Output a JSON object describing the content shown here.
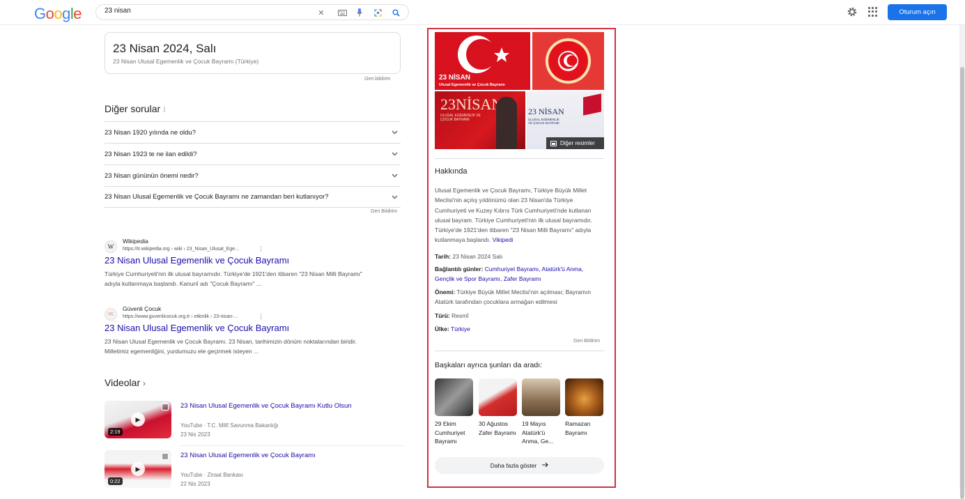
{
  "header": {
    "logo_letters": [
      "G",
      "o",
      "o",
      "g",
      "l",
      "e"
    ],
    "search_query": "23 nisan",
    "signin_label": "Oturum açın"
  },
  "date_card": {
    "title": "23 Nisan 2024, Salı",
    "subtitle": "23 Nisan Ulusal Egemenlik ve Çocuk Bayramı (Türkiye)",
    "feedback": "Geri bildirim"
  },
  "paa": {
    "title": "Diğer sorular",
    "items": [
      "23 Nisan 1920 yılında ne oldu?",
      "23 Nisan 1923 te ne ilan edildi?",
      "23 Nisan gününün önemi nedir?",
      "23 Nisan Ulusal Egemenlik ve Çocuk Bayramı ne zamandan beri kutlanıyor?"
    ],
    "feedback": "Geri Bildirim"
  },
  "results": [
    {
      "favicon": "W",
      "site": "Wikipedia",
      "url": "https://tr.wikipedia.org › wiki › 23_Nisan_Ulusal_Ege...",
      "title": "23 Nisan Ulusal Egemenlik ve Çocuk Bayramı",
      "snippet": "Türkiye Cumhuriyeti'nin ilk ulusal bayramıdır. Türkiye'de 1921'den itibaren \"23 Nisan Milli Bayramı\" adıyla kutlanmaya başlandı. Kanunî adı \"Çocuk Bayramı\" ..."
    },
    {
      "favicon": "GÇ",
      "site": "Güvenli Çocuk",
      "url": "https://www.guvenlicocuk.org.tr › etkinlik › 23-nisan-...",
      "title": "23 Nisan Ulusal Egemenlik ve Çocuk Bayramı",
      "snippet": "23 Nisan Ulusal Egemenlik ve Çocuk Bayramı. 23 Nisan, tarihimizin dönüm noktalarından biridir. Milletimiz egemenliğini, yurdumuzu ele geçirmek isteyen ..."
    }
  ],
  "videos": {
    "title": "Videolar",
    "items": [
      {
        "title": "23 Nisan Ulusal Egemenlik ve Çocuk Bayramı Kutlu Olsun",
        "source": "YouTube · T.C. Millî Savunma Bakanlığı",
        "date": "23 Nis 2023",
        "duration": "2:19"
      },
      {
        "title": "23 Nisan Ulusal Egemenlik ve Çocuk Bayramı",
        "source": "YouTube · Ziraat Bankası",
        "date": "22 Nis 2023",
        "duration": "0:22"
      }
    ]
  },
  "knowledge_panel": {
    "image1_title": "23 NİSAN",
    "image1_sub": "Ulusal Egemenlik ve Çocuk Bayramı",
    "image3_title": "23NİSAN",
    "image3_sub": "ULUSAL EGEMENLİK VE ÇOCUK BAYRAMI",
    "image4_title": "23 NİSAN",
    "image4_sub": "ULUSAL EGEMENLİK VE ÇOCUK BAYRAMI",
    "more_images": "Diğer resimler",
    "about_title": "Hakkında",
    "about_text": "Ulusal Egemenlik ve Çocuk Bayramı, Türkiye Büyük Millet Meclisi'nin açılış yıldönümü olan 23 Nisan'da Türkiye Cumhuriyeti ve Kuzey Kıbrıs Türk Cumhuriyeti'nde kutlanan ulusal bayram. Türkiye Cumhuriyeti'nin ilk ulusal bayramıdır. Türkiye'de 1921'den itibaren \"23 Nisan Milli Bayramı\" adıyla kutlanmaya başlandı.",
    "about_link": "Vikipedi",
    "facts": {
      "date_label": "Tarih:",
      "date_value": "23 Nisan 2024 Salı",
      "related_label": "Bağlantılı günler:",
      "related_value": "Cumhuriyet Bayramı, Atatürk'ü Anma, Gençlik ve Spor Bayramı, Zafer Bayramı",
      "importance_label": "Önemi:",
      "importance_value": "Türkiye Büyük Millet Meclisi'nin açılması; Bayramın Atatürk tarafından çocuklara armağan edilmesi",
      "type_label": "Türü:",
      "type_value": "Resmî",
      "country_label": "Ülke:",
      "country_value": "Türkiye"
    },
    "feedback": "Geri Bildirim",
    "others_title": "Başkaları ayrıca şunları da aradı:",
    "others": [
      "29 Ekim Cumhuriyet Bayramı",
      "30 Ağustos Zafer Bayramı",
      "19 Mayıs Atatürk'ü Anma, Ge...",
      "Ramazan Bayramı"
    ],
    "more_button": "Daha fazla göster"
  },
  "colors": {
    "link": "#1a0dab",
    "signin_bg": "#1a73e8",
    "highlight_border": "#d0323d",
    "flag_red": "#d7121e"
  }
}
